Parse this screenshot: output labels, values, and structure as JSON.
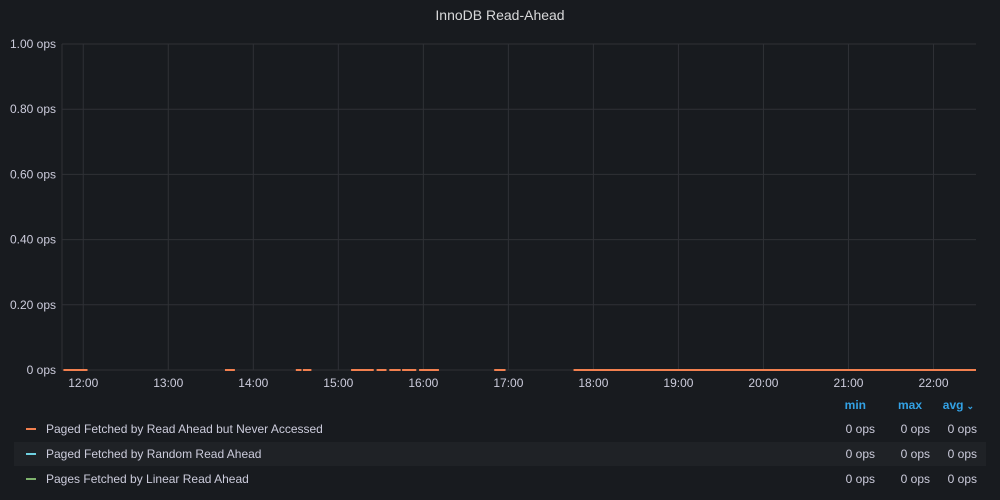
{
  "panel": {
    "title": "InnoDB Read-Ahead"
  },
  "chart_data": {
    "type": "line",
    "title": "InnoDB Read-Ahead",
    "xlabel": "",
    "ylabel": "",
    "y_ticks": [
      "1.00 ops",
      "0.80 ops",
      "0.60 ops",
      "0.40 ops",
      "0.20 ops",
      "0 ops"
    ],
    "y_tick_values": [
      1.0,
      0.8,
      0.6,
      0.4,
      0.2,
      0
    ],
    "ylim": [
      0,
      1
    ],
    "x_ticks": [
      "12:00",
      "13:00",
      "14:00",
      "15:00",
      "16:00",
      "17:00",
      "18:00",
      "19:00",
      "20:00",
      "21:00",
      "22:00"
    ],
    "xlim": [
      "11:45",
      "22:30"
    ],
    "grid": true,
    "legend_position": "bottom",
    "series": [
      {
        "name": "Paged Fetched by Read Ahead but Never Accessed",
        "color": "#f2804f",
        "segments": [
          [
            "11:46",
            "12:03"
          ],
          [
            "13:40",
            "13:47"
          ],
          [
            "14:30",
            "14:34"
          ],
          [
            "14:35",
            "14:41"
          ],
          [
            "15:09",
            "15:25"
          ],
          [
            "15:27",
            "15:34"
          ],
          [
            "15:36",
            "15:44"
          ],
          [
            "15:45",
            "15:55"
          ],
          [
            "15:57",
            "16:11"
          ],
          [
            "16:50",
            "16:58"
          ],
          [
            "17:46",
            "22:30"
          ]
        ],
        "value": 0
      },
      {
        "name": "Paged Fetched by Random Read Ahead",
        "color": "#6ed0e0",
        "segments": [],
        "value": 0
      },
      {
        "name": "Pages Fetched by Linear Read Ahead",
        "color": "#7eb26d",
        "segments": [],
        "value": 0
      }
    ]
  },
  "legend": {
    "headers": {
      "min": "min",
      "max": "max",
      "avg": "avg"
    },
    "rows": [
      {
        "name": "Paged Fetched by Read Ahead but Never Accessed",
        "color": "#f2804f",
        "min": "0 ops",
        "max": "0 ops",
        "avg": "0 ops"
      },
      {
        "name": "Paged Fetched by Random Read Ahead",
        "color": "#6ed0e0",
        "min": "0 ops",
        "max": "0 ops",
        "avg": "0 ops"
      },
      {
        "name": "Pages Fetched by Linear Read Ahead",
        "color": "#7eb26d",
        "min": "0 ops",
        "max": "0 ops",
        "avg": "0 ops"
      }
    ]
  }
}
